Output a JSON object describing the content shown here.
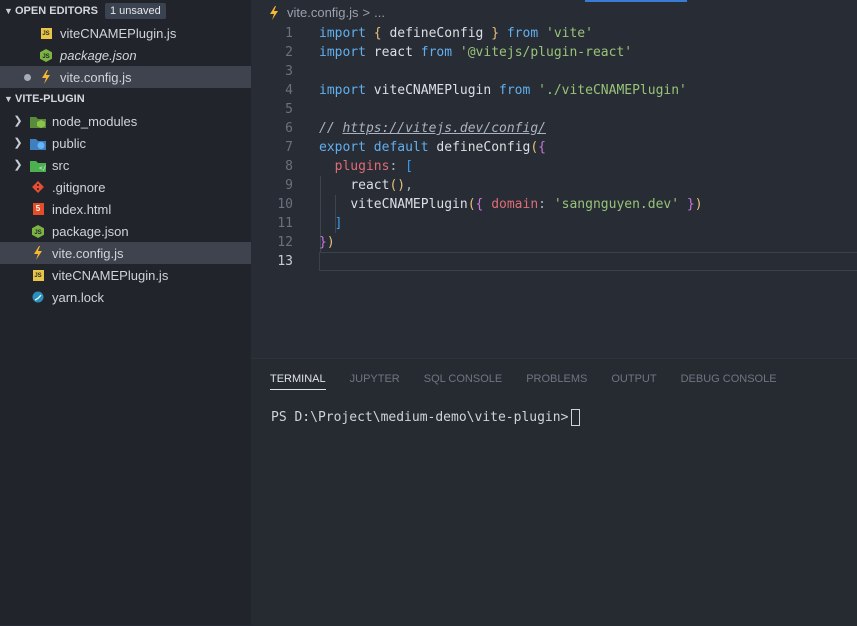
{
  "sidebar": {
    "open_editors": {
      "title": "OPEN EDITORS",
      "badge": "1 unsaved",
      "files": [
        {
          "name": "viteCNAMEPlugin.js",
          "icon": "js-file-icon"
        },
        {
          "name": "package.json",
          "icon": "node-json-icon"
        },
        {
          "name": "vite.config.js",
          "icon": "vite-lightning-icon"
        }
      ]
    },
    "project": {
      "title": "VITE-PLUGIN",
      "items": [
        {
          "name": "node_modules",
          "icon": "node-modules-folder-icon",
          "type": "folder"
        },
        {
          "name": "public",
          "icon": "public-folder-icon",
          "type": "folder"
        },
        {
          "name": "src",
          "icon": "src-folder-icon",
          "type": "folder"
        },
        {
          "name": ".gitignore",
          "icon": "git-icon",
          "type": "file"
        },
        {
          "name": "index.html",
          "icon": "html5-icon",
          "type": "file"
        },
        {
          "name": "package.json",
          "icon": "node-json-icon",
          "type": "file"
        },
        {
          "name": "vite.config.js",
          "icon": "vite-lightning-icon",
          "type": "file"
        },
        {
          "name": "viteCNAMEPlugin.js",
          "icon": "js-file-icon",
          "type": "file"
        },
        {
          "name": "yarn.lock",
          "icon": "yarn-icon",
          "type": "file"
        }
      ]
    }
  },
  "editor": {
    "breadcrumb": {
      "file": "vite.config.js",
      "sep": ">",
      "more": "..."
    },
    "current_line": 13,
    "lines": [
      {
        "n": "1",
        "text": "import { defineConfig } from 'vite'"
      },
      {
        "n": "2",
        "text": "import react from '@vitejs/plugin-react'"
      },
      {
        "n": "3",
        "text": ""
      },
      {
        "n": "4",
        "text": "import viteCNAMEPlugin from './viteCNAMEPlugin'"
      },
      {
        "n": "5",
        "text": ""
      },
      {
        "n": "6",
        "text": "// https://vitejs.dev/config/"
      },
      {
        "n": "7",
        "text": "export default defineConfig({"
      },
      {
        "n": "8",
        "text": "  plugins: ["
      },
      {
        "n": "9",
        "text": "    react(),"
      },
      {
        "n": "10",
        "text": "    viteCNAMEPlugin({ domain: 'sangnguyen.dev' })"
      },
      {
        "n": "11",
        "text": "  ]"
      },
      {
        "n": "12",
        "text": "})"
      },
      {
        "n": "13",
        "text": ""
      }
    ]
  },
  "panel": {
    "tabs": [
      "TERMINAL",
      "JUPYTER",
      "SQL CONSOLE",
      "PROBLEMS",
      "OUTPUT",
      "DEBUG CONSOLE"
    ],
    "active_tab": "TERMINAL",
    "prompt": "PS D:\\Project\\medium-demo\\vite-plugin>"
  },
  "colors": {
    "sidebar_bg": "#21252b",
    "editor_bg": "#282c34",
    "selection": "#3e434d",
    "keyword": "#61afef",
    "string": "#98c379",
    "property": "#e06c75",
    "accent_bracket": "#e5c07b"
  }
}
